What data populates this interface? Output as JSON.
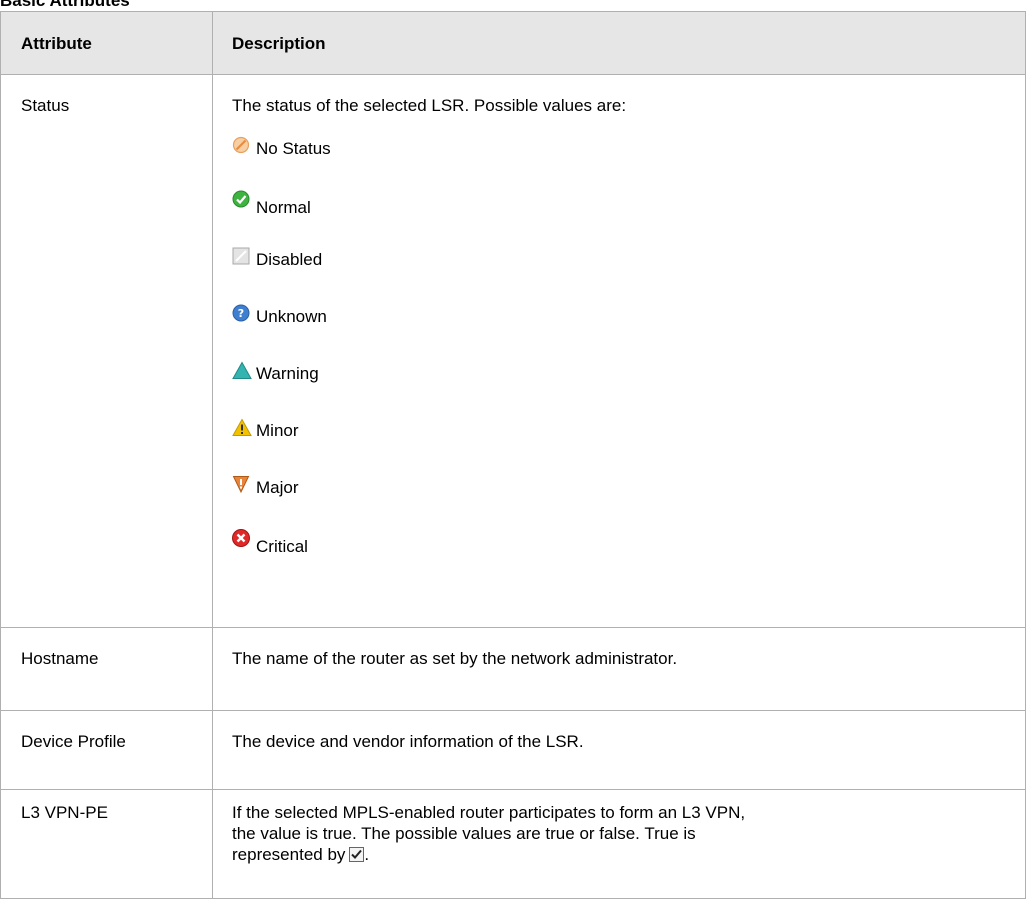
{
  "section": {
    "title": "Basic Attributes"
  },
  "table": {
    "headers": {
      "attribute": "Attribute",
      "description": "Description"
    },
    "status_row": {
      "attribute": "Status",
      "intro": "The status of the selected LSR. Possible values are:",
      "values": [
        {
          "label": "No Status",
          "icon": "no-status-icon"
        },
        {
          "label": "Normal",
          "icon": "normal-icon"
        },
        {
          "label": "Disabled",
          "icon": "disabled-icon"
        },
        {
          "label": "Unknown",
          "icon": "unknown-icon"
        },
        {
          "label": "Warning",
          "icon": "warning-icon"
        },
        {
          "label": "Minor",
          "icon": "minor-icon"
        },
        {
          "label": "Major",
          "icon": "major-icon"
        },
        {
          "label": "Critical",
          "icon": "critical-icon"
        }
      ]
    },
    "hostname_row": {
      "attribute": "Hostname",
      "description": "The name of the router as set by the network administrator."
    },
    "device_profile_row": {
      "attribute": "Device Profile",
      "description": "The device and vendor information of the LSR."
    },
    "l3vpn_row": {
      "attribute": "L3 VPN-PE",
      "line1": "If the selected MPLS-enabled router participates to form an L3 VPN,",
      "line2": "the value is true. The possible values are true or false. True is",
      "line3_prefix": "represented by",
      "line3_suffix": "."
    }
  },
  "colors": {
    "header_bg": "#e6e6e6",
    "border": "#b0b0b0",
    "normal": "#3eb340",
    "unknown": "#3f7fd0",
    "warning": "#34b3b0",
    "minor": "#f2c200",
    "major": "#e8853a",
    "critical": "#e02828"
  }
}
